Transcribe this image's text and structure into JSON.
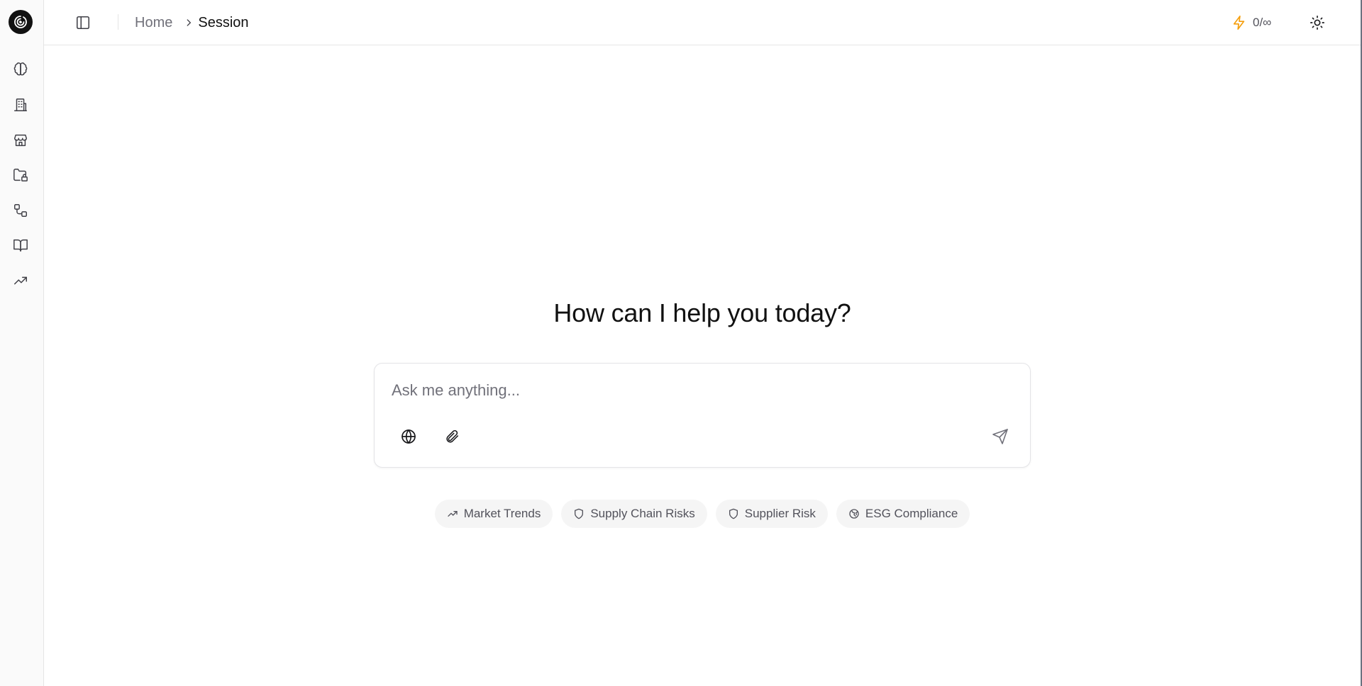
{
  "header": {
    "breadcrumb": {
      "home": "Home",
      "current": "Session"
    },
    "usage": "0/∞"
  },
  "rail": {
    "items": [
      {
        "icon": "brain-icon"
      },
      {
        "icon": "building-icon"
      },
      {
        "icon": "store-icon"
      },
      {
        "icon": "folder-lock-icon"
      },
      {
        "icon": "workflow-icon"
      },
      {
        "icon": "book-open-icon"
      },
      {
        "icon": "trending-up-icon"
      }
    ]
  },
  "main": {
    "greeting": "How can I help you today?",
    "input_placeholder": "Ask me anything...",
    "suggestions": [
      {
        "label": "Market Trends",
        "icon": "trending-up-icon"
      },
      {
        "label": "Supply Chain Risks",
        "icon": "shield-icon"
      },
      {
        "label": "Supplier Risk",
        "icon": "shield-icon"
      },
      {
        "label": "ESG Compliance",
        "icon": "globe-leaf-icon"
      }
    ]
  },
  "colors": {
    "accent_bolt": "#f59e0b",
    "muted_text": "#71717a",
    "border": "#e5e5e5"
  }
}
